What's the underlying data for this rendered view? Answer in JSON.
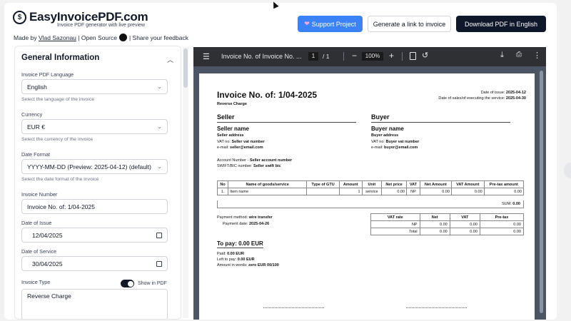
{
  "header": {
    "logo_text": "EasyInvoicePDF.com",
    "tagline": "Invoice PDF generator with live preview",
    "made_by_prefix": "Made by",
    "author": "Vlad Sazonau",
    "open_source": "| Open Source",
    "feedback": "| Share your feedback",
    "support_label": "Support Project",
    "link_label": "Generate a link to invoice",
    "download_label": "Download PDF in English",
    "accent_color": "#3b82f6"
  },
  "sidebar": {
    "section_title": "General Information",
    "language": {
      "label": "Invoice PDF Language",
      "value": "English",
      "hint": "Select the language of the invoice"
    },
    "currency": {
      "label": "Currency",
      "value": "EUR €",
      "hint": "Select the currency of the invoice"
    },
    "date_format": {
      "label": "Date Format",
      "value": "YYYY-MM-DD (Preview: 2025-04-12) (default)",
      "hint": "Select the date format of the invoice"
    },
    "invoice_number": {
      "label": "Invoice Number",
      "value": "Invoice No. of: 1/04-2025"
    },
    "date_of_issue": {
      "label": "Date of Issue",
      "value": "12/04/2025"
    },
    "date_of_service": {
      "label": "Date of Service",
      "value": "30/04/2025"
    },
    "invoice_type": {
      "label": "Invoice Type",
      "toggle_label": "Show in PDF",
      "toggle_on": true,
      "value": "Reverse Charge"
    }
  },
  "viewer": {
    "doc_title": "Invoice No. of Invoice No. ...",
    "page": "1",
    "page_total": "/ 1",
    "zoom": "100%"
  },
  "invoice": {
    "title": "Invoice No. of: 1/04-2025",
    "subtitle": "Reverse Charge",
    "issue_label": "Date of issue:",
    "issue_date": "2025-04-12",
    "sale_label": "Date of sales/of executing the service:",
    "sale_date": "2025-04-30",
    "seller": {
      "heading": "Seller",
      "name": "Seller name",
      "address": "Seller address",
      "vat_label": "VAT no:",
      "vat": "Seller vat number",
      "email_label": "e-mail:",
      "email": "seller@email.com",
      "account_label": "Account Number -",
      "account": "Seller account number",
      "swift_label": "SWIFT/BIC number:",
      "swift": "Seller swift bic"
    },
    "buyer": {
      "heading": "Buyer",
      "name": "Buyer name",
      "address": "Buyer address",
      "vat_label": "VAT no:",
      "vat": "Buyer vat number",
      "email_label": "e-mail:",
      "email": "buyer@email.com"
    },
    "items_headers": [
      "No",
      "Name of goods/service",
      "Type of GTU",
      "Amount",
      "Unit",
      "Net price",
      "VAT",
      "Net Amount",
      "VAT Amount",
      "Pre-tax amount"
    ],
    "items": [
      [
        "1.",
        "Item name",
        "",
        "1",
        "service",
        "0.00",
        "NP",
        "0.00",
        "0.00",
        "0.00"
      ]
    ],
    "sum_label": "SUM:",
    "sum_value": "0.00",
    "payment_method_label": "Payment method:",
    "payment_method": "wire transfer",
    "payment_date_label": "Payment date:",
    "payment_date": "2025-04-26",
    "vat_headers": [
      "VAT rate",
      "Net",
      "VAT",
      "Pre-tax"
    ],
    "vat_rows": [
      [
        "NP",
        "0.00",
        "0.00",
        "0.00"
      ],
      [
        "Total",
        "0.00",
        "0.00",
        "0.00"
      ]
    ],
    "to_pay": "To pay: 0.00 EUR",
    "paid_label": "Paid:",
    "paid": "0.00 EUR",
    "left_label": "Left to pay:",
    "left": "0.00 EUR",
    "words_label": "Amount in words:",
    "words": "zero EUR 00/100"
  }
}
